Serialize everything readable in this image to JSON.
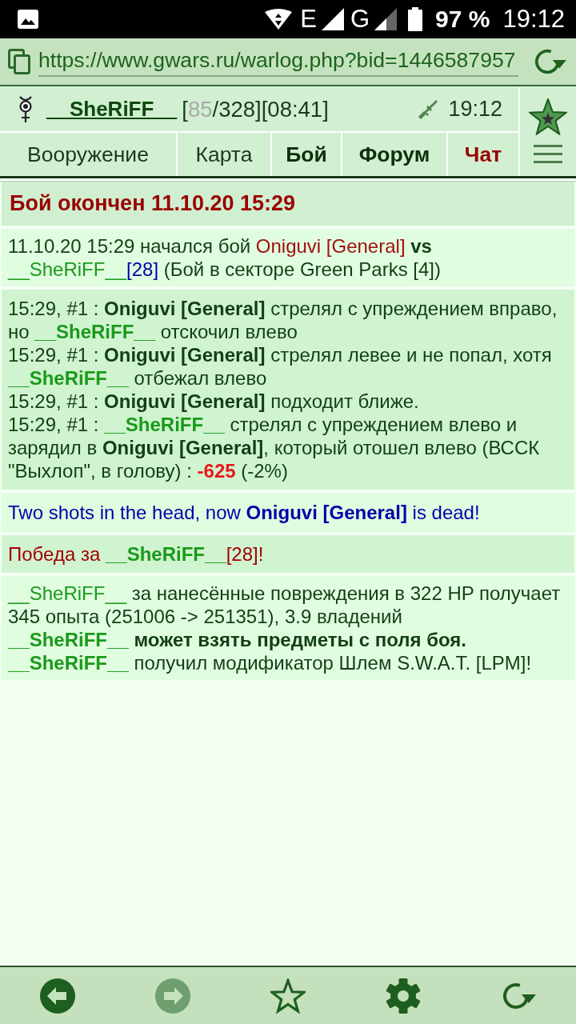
{
  "status_bar": {
    "networks": [
      {
        "label": "E"
      },
      {
        "label": "G"
      }
    ],
    "battery": "97 %",
    "time": "19:12"
  },
  "address_bar": {
    "url": "https://www.gwars.ru/warlog.php?bid=1446587957"
  },
  "header": {
    "player": {
      "name": "__SheRiFF__",
      "stats": [
        {
          "kind": "text",
          "text": "["
        },
        {
          "kind": "muted",
          "text": "85"
        },
        {
          "kind": "text",
          "text": "/328][08:41]"
        }
      ]
    },
    "time": "19:12",
    "tabs": [
      {
        "label": "Вооружение",
        "kind": "normal"
      },
      {
        "label": "Карта",
        "kind": "normal"
      },
      {
        "label": "Бой",
        "kind": "bold"
      },
      {
        "label": "Форум",
        "kind": "bold"
      },
      {
        "label": "Чат",
        "kind": "alert"
      }
    ]
  },
  "title": "Бой окончен 11.10.20 15:29",
  "log": [
    {
      "kind": "start",
      "lines": [
        {
          "segments": [
            {
              "kind": "text",
              "text": "11.10.20 15:29 начался бой "
            },
            {
              "kind": "enemy",
              "text": "Oniguvi [General]"
            },
            {
              "kind": "bold",
              "text": " vs "
            },
            {
              "kind": "player",
              "text": "__SheRiFF__"
            },
            {
              "kind": "level",
              "text": "[28]"
            },
            {
              "kind": "text",
              "text": " (Бой в секторе Green Parks [4])"
            }
          ]
        }
      ]
    },
    {
      "kind": "actions",
      "lines": [
        {
          "segments": [
            {
              "kind": "text",
              "text": "15:29, #1 : "
            },
            {
              "kind": "bold",
              "text": "Oniguvi [General]"
            },
            {
              "kind": "text",
              "text": " стрелял с упреждением вправо, но "
            },
            {
              "kind": "player_bold",
              "text": "__SheRiFF__"
            },
            {
              "kind": "text",
              "text": " отскочил влево"
            }
          ]
        },
        {
          "segments": [
            {
              "kind": "text",
              "text": "15:29, #1 : "
            },
            {
              "kind": "bold",
              "text": "Oniguvi [General]"
            },
            {
              "kind": "text",
              "text": " стрелял левее и не попал, хотя "
            },
            {
              "kind": "player_bold",
              "text": "__SheRiFF__"
            },
            {
              "kind": "text",
              "text": " отбежал влево"
            }
          ]
        },
        {
          "segments": [
            {
              "kind": "text",
              "text": "15:29, #1 : "
            },
            {
              "kind": "bold",
              "text": "Oniguvi [General]"
            },
            {
              "kind": "text",
              "text": " подходит ближе."
            }
          ]
        },
        {
          "segments": [
            {
              "kind": "text",
              "text": "15:29, #1 : "
            },
            {
              "kind": "player_bold",
              "text": "__SheRiFF__"
            },
            {
              "kind": "text",
              "text": " стрелял с упреждением влево и зарядил в "
            },
            {
              "kind": "bold",
              "text": "Oniguvi [General]"
            },
            {
              "kind": "text",
              "text": ", который отошел влево (ВССК \"Выхлоп\", в голову) : "
            },
            {
              "kind": "damage",
              "text": "-625"
            },
            {
              "kind": "text",
              "text": " (-2%)"
            }
          ]
        }
      ]
    },
    {
      "kind": "info",
      "lines": [
        {
          "segments": [
            {
              "kind": "text",
              "text": "Two shots in the head, now "
            },
            {
              "kind": "bold",
              "text": "Oniguvi [General]"
            },
            {
              "kind": "text",
              "text": " is dead!"
            }
          ]
        }
      ]
    },
    {
      "kind": "victory",
      "lines": [
        {
          "segments": [
            {
              "kind": "text",
              "text": "Победа за "
            },
            {
              "kind": "player_bold",
              "text": "__SheRiFF__"
            },
            {
              "kind": "text",
              "text": "[28]!"
            }
          ]
        }
      ]
    },
    {
      "kind": "result",
      "lines": [
        {
          "segments": [
            {
              "kind": "player",
              "text": "__SheRiFF__"
            },
            {
              "kind": "text",
              "text": " за нанесённые повреждения в 322 HP получает 345 опыта (251006 -> 251351), 3.9 владений"
            }
          ]
        },
        {
          "segments": [
            {
              "kind": "player_bold",
              "text": "__SheRiFF__"
            },
            {
              "kind": "bold",
              "text": " может взять предметы с поля боя."
            }
          ]
        },
        {
          "segments": [
            {
              "kind": "player_bold",
              "text": "__SheRiFF__"
            },
            {
              "kind": "text",
              "text": " получил модификатор Шлем S.W.A.T. [LPM]!"
            }
          ]
        }
      ]
    }
  ],
  "bottom_toolbar": {
    "buttons": [
      {
        "kind": "back",
        "disabled": false
      },
      {
        "kind": "forward",
        "disabled": true
      },
      {
        "kind": "bookmark",
        "disabled": false
      },
      {
        "kind": "settings",
        "disabled": false
      },
      {
        "kind": "reload",
        "disabled": false
      }
    ]
  }
}
